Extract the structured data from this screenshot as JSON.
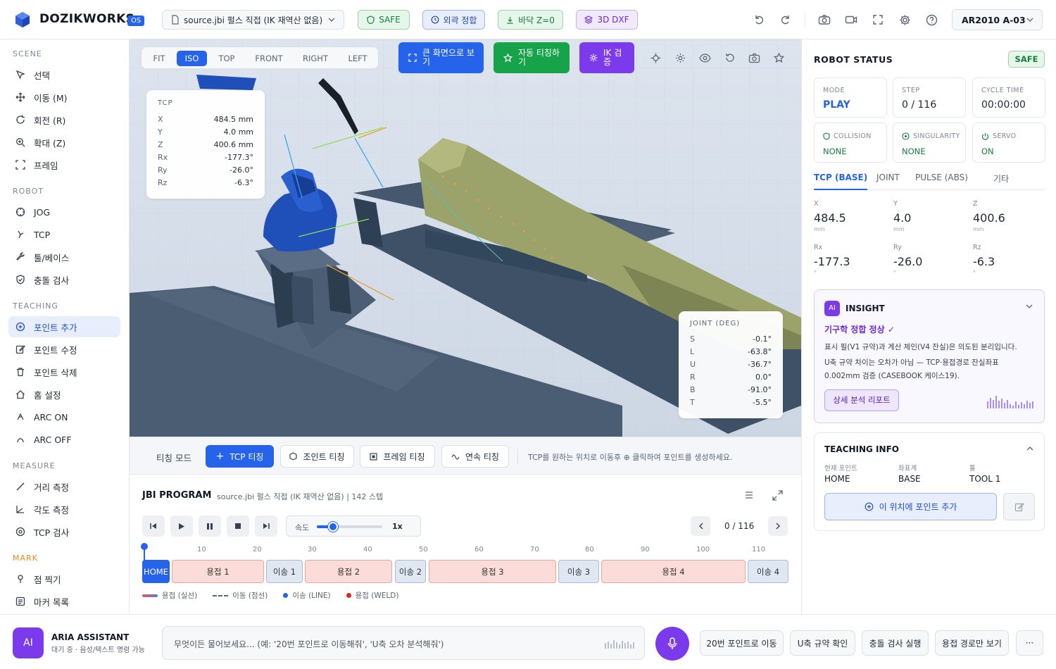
{
  "header": {
    "app_name": "DOZIKWORKS",
    "app_badge": "OS",
    "file_name": "source.jbi 펄스 직접 (IK 재역산 없음)",
    "badges": {
      "safe": "SAFE",
      "outer": "외곽 정합",
      "floor": "바닥 Z=0",
      "dxf": "3D DXF"
    },
    "robot_model": "AR2010 A-03"
  },
  "sidebar": {
    "scene_title": "SCENE",
    "scene_items": [
      "선택",
      "이동 (M)",
      "회전 (R)",
      "확대 (Z)",
      "프레임"
    ],
    "robot_title": "ROBOT",
    "robot_items": [
      "JOG",
      "TCP",
      "툴/베이스",
      "충돌 검사"
    ],
    "teaching_title": "TEACHING",
    "teaching_items": [
      "포인트 추가",
      "포인트 수정",
      "포인트 삭제",
      "홈 설정",
      "ARC ON",
      "ARC OFF"
    ],
    "measure_title": "MEASURE",
    "measure_items": [
      "거리 측정",
      "각도 측정",
      "TCP 검사"
    ],
    "mark_title": "MARK",
    "mark_items": [
      "점 찍기",
      "마커 목록"
    ]
  },
  "view": {
    "views": [
      "FIT",
      "ISO",
      "TOP",
      "FRONT",
      "RIGHT",
      "LEFT"
    ],
    "active_view": "ISO",
    "big_view_btn": [
      "큰 화면으로 보",
      "기"
    ],
    "auto_teach_btn": [
      "자동 티칭하",
      "기"
    ],
    "ik_btn": [
      "IK 검",
      "증"
    ]
  },
  "tcp_card": {
    "title": "TCP",
    "rows": [
      {
        "k": "X",
        "v": "484.5 mm"
      },
      {
        "k": "Y",
        "v": "4.0 mm"
      },
      {
        "k": "Z",
        "v": "400.6 mm"
      },
      {
        "k": "Rx",
        "v": "-177.3°"
      },
      {
        "k": "Ry",
        "v": "-26.0°"
      },
      {
        "k": "Rz",
        "v": "-6.3°"
      }
    ]
  },
  "joint_card": {
    "title": "JOINT (DEG)",
    "rows": [
      {
        "k": "S",
        "v": "-0.1°"
      },
      {
        "k": "L",
        "v": "-63.8°"
      },
      {
        "k": "U",
        "v": "-36.7°"
      },
      {
        "k": "R",
        "v": "0.0°"
      },
      {
        "k": "B",
        "v": "-91.0°"
      },
      {
        "k": "T",
        "v": "-5.5°"
      }
    ]
  },
  "teach_bar": {
    "mode_label": "티칭 모드",
    "buttons": [
      "TCP 티칭",
      "조인트 티칭",
      "프레임 티칭",
      "연속 티칭"
    ],
    "hint": "TCP를 원하는 위치로 이동후 ⊕ 클릭하여 포인트를 생성하세요."
  },
  "program": {
    "title": "JBI PROGRAM",
    "subtitle": "source.jbi 펄스 직접 (IK 재역산 없음) | 142 스텝",
    "speed_label": "속도",
    "speed_value": "1x",
    "speed_level": 0.25,
    "step_counter": "0 / 116",
    "ticks": [
      "10",
      "20",
      "30",
      "40",
      "50",
      "60",
      "70",
      "80",
      "90",
      "100",
      "110"
    ],
    "segments": [
      {
        "label": "HOME",
        "type": "home"
      },
      {
        "label": "용접 1",
        "type": "weld"
      },
      {
        "label": "이송 1",
        "type": "move"
      },
      {
        "label": "용접 2",
        "type": "weld"
      },
      {
        "label": "이송 2",
        "type": "move"
      },
      {
        "label": "용접 3",
        "type": "weld"
      },
      {
        "label": "이송 3",
        "type": "move"
      },
      {
        "label": "용접 4",
        "type": "weld"
      },
      {
        "label": "이송 4",
        "type": "move"
      }
    ],
    "legend": [
      "용접 (실선)",
      "이동 (점선)",
      "이송 (LINE)",
      "용접 (WELD)"
    ]
  },
  "robot_status": {
    "title": "ROBOT STATUS",
    "badge": "SAFE",
    "mode_label": "MODE",
    "mode_value": "PLAY",
    "step_label": "STEP",
    "step_value": "0 / 116",
    "cycle_label": "CYCLE TIME",
    "cycle_value": "00:00:00",
    "collision_label": "COLLISION",
    "collision_value": "NONE",
    "singularity_label": "SINGULARITY",
    "singularity_value": "NONE",
    "servo_label": "SERVO",
    "servo_value": "ON",
    "tabs": [
      "TCP (BASE)",
      "JOINT",
      "PULSE (ABS)",
      "기타"
    ],
    "coords": [
      {
        "k": "X",
        "v": "484.5",
        "u": "mm"
      },
      {
        "k": "Y",
        "v": "4.0",
        "u": "mm"
      },
      {
        "k": "Z",
        "v": "400.6",
        "u": "mm"
      },
      {
        "k": "Rx",
        "v": "-177.3",
        "u": "°"
      },
      {
        "k": "Ry",
        "v": "-26.0",
        "u": "°"
      },
      {
        "k": "Rz",
        "v": "-6.3",
        "u": "°"
      }
    ]
  },
  "insight": {
    "badge": "AI",
    "title": "INSIGHT",
    "headline": "기구학 정합 정상 ✓",
    "line1": "표시 필(V1 규약)과 계산 체인(V4 잔실)은 의도된 분리입니다.",
    "line2": "U축 규약 차이는 오차가 아님 — TCP·용접경로 잔실좌표",
    "line3": "0.002mm 검증 (CASEBOOK 케이스19).",
    "button": "상세 분석 리포트"
  },
  "teaching_info": {
    "title": "TEACHING INFO",
    "labels": [
      "현재 포인트",
      "좌표계",
      "툴"
    ],
    "values": [
      "HOME",
      "BASE",
      "TOOL 1"
    ],
    "add_button": "이 위치에 포인트 추가"
  },
  "assistant": {
    "badge": "AI",
    "name": "ARIA ASSISTANT",
    "status": "대기 중 · 음성/텍스트 명령 가능",
    "placeholder": "무엇이든 물어보세요... (예: '20번 포인트로 이동해줘', 'U축 오차 분석해줘')",
    "chips": [
      "20번 포인트로 이동",
      "U축 규약 확인",
      "충돌 검사 실행",
      "용접 경로만 보기"
    ],
    "more": "···"
  },
  "colors": {
    "accent": "#2563eb",
    "green": "#15a34a",
    "purple": "#7c3aed",
    "weld": "#fbdcd8",
    "move": "#dfe7f3"
  }
}
